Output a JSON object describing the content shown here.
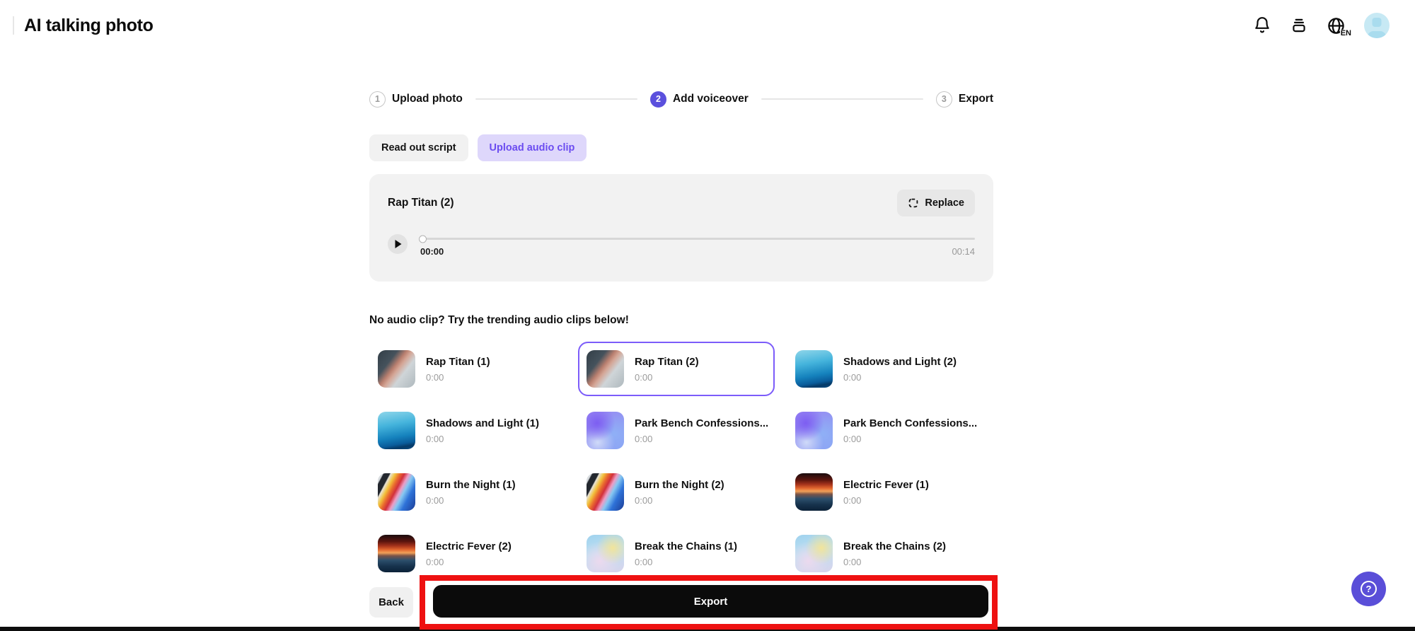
{
  "app": {
    "title": "AI talking photo"
  },
  "header": {
    "language_label": "EN",
    "icons": [
      "notification-bell-icon",
      "stack-icon",
      "language-globe-icon",
      "avatar"
    ]
  },
  "stepper": {
    "steps": [
      {
        "number": "1",
        "label": "Upload photo",
        "active": false
      },
      {
        "number": "2",
        "label": "Add voiceover",
        "active": true
      },
      {
        "number": "3",
        "label": "Export",
        "active": false
      }
    ]
  },
  "tabs": [
    {
      "label": "Read out script",
      "active": false
    },
    {
      "label": "Upload audio clip",
      "active": true
    }
  ],
  "player": {
    "title": "Rap Titan (2)",
    "replace_label": "Replace",
    "current_time": "00:00",
    "total_time": "00:14",
    "progress_percent": 0
  },
  "trending": {
    "heading": "No audio clip? Try the trending audio clips below!",
    "clips": [
      {
        "title": "Rap Titan (1)",
        "duration": "0:00",
        "art": "rap-titan",
        "selected": false
      },
      {
        "title": "Rap Titan (2)",
        "duration": "0:00",
        "art": "rap-titan",
        "selected": true
      },
      {
        "title": "Shadows and Light (2)",
        "duration": "0:00",
        "art": "shadows",
        "selected": false
      },
      {
        "title": "Shadows and Light (1)",
        "duration": "0:00",
        "art": "shadows",
        "selected": false
      },
      {
        "title": "Park Bench Confessions...",
        "duration": "0:00",
        "art": "park",
        "selected": false
      },
      {
        "title": "Park Bench Confessions...",
        "duration": "0:00",
        "art": "park",
        "selected": false
      },
      {
        "title": "Burn the Night (1)",
        "duration": "0:00",
        "art": "burn",
        "selected": false
      },
      {
        "title": "Burn the Night (2)",
        "duration": "0:00",
        "art": "burn",
        "selected": false
      },
      {
        "title": "Electric Fever (1)",
        "duration": "0:00",
        "art": "electric",
        "selected": false
      },
      {
        "title": "Electric Fever (2)",
        "duration": "0:00",
        "art": "electric",
        "selected": false
      },
      {
        "title": "Break the Chains (1)",
        "duration": "0:00",
        "art": "break",
        "selected": false
      },
      {
        "title": "Break the Chains (2)",
        "duration": "0:00",
        "art": "break",
        "selected": false
      }
    ]
  },
  "footer": {
    "back_label": "Back",
    "export_label": "Export"
  },
  "help_button": {
    "symbol": "?"
  },
  "annotation": {
    "shape": "red-rectangle",
    "highlights": "export-button",
    "color": "#ee1111"
  },
  "colors": {
    "accent_purple": "#5b50dd",
    "tab_active_bg": "#ded7fb",
    "tab_active_text": "#6b4cf0",
    "selected_card_border": "#7c5cfa",
    "help_button_bg": "#5a4ed8",
    "export_button_bg": "#0b0b0b",
    "annotation_red": "#ee1111",
    "card_bg": "#f2f2f2",
    "avatar_bg": "#c7e9f4"
  }
}
